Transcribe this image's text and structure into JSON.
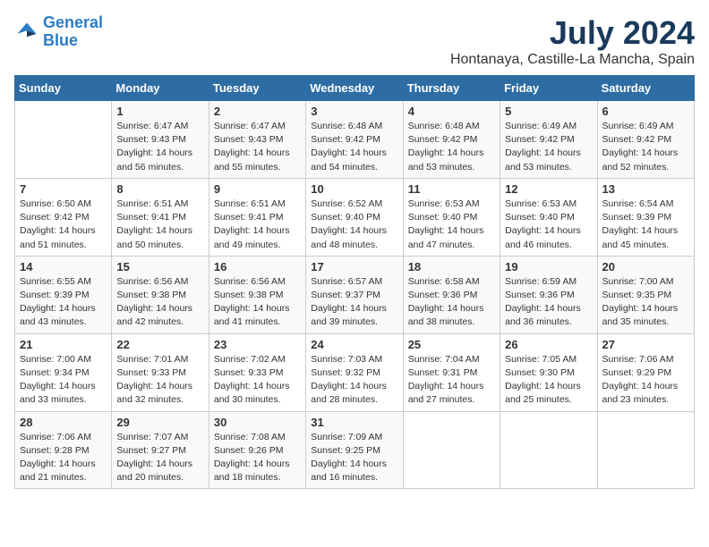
{
  "logo": {
    "line1": "General",
    "line2": "Blue"
  },
  "title": "July 2024",
  "location": "Hontanaya, Castille-La Mancha, Spain",
  "weekdays": [
    "Sunday",
    "Monday",
    "Tuesday",
    "Wednesday",
    "Thursday",
    "Friday",
    "Saturday"
  ],
  "weeks": [
    [
      {
        "day": "",
        "sunrise": "",
        "sunset": "",
        "daylight": ""
      },
      {
        "day": "1",
        "sunrise": "Sunrise: 6:47 AM",
        "sunset": "Sunset: 9:43 PM",
        "daylight": "Daylight: 14 hours and 56 minutes."
      },
      {
        "day": "2",
        "sunrise": "Sunrise: 6:47 AM",
        "sunset": "Sunset: 9:43 PM",
        "daylight": "Daylight: 14 hours and 55 minutes."
      },
      {
        "day": "3",
        "sunrise": "Sunrise: 6:48 AM",
        "sunset": "Sunset: 9:42 PM",
        "daylight": "Daylight: 14 hours and 54 minutes."
      },
      {
        "day": "4",
        "sunrise": "Sunrise: 6:48 AM",
        "sunset": "Sunset: 9:42 PM",
        "daylight": "Daylight: 14 hours and 53 minutes."
      },
      {
        "day": "5",
        "sunrise": "Sunrise: 6:49 AM",
        "sunset": "Sunset: 9:42 PM",
        "daylight": "Daylight: 14 hours and 53 minutes."
      },
      {
        "day": "6",
        "sunrise": "Sunrise: 6:49 AM",
        "sunset": "Sunset: 9:42 PM",
        "daylight": "Daylight: 14 hours and 52 minutes."
      }
    ],
    [
      {
        "day": "7",
        "sunrise": "Sunrise: 6:50 AM",
        "sunset": "Sunset: 9:42 PM",
        "daylight": "Daylight: 14 hours and 51 minutes."
      },
      {
        "day": "8",
        "sunrise": "Sunrise: 6:51 AM",
        "sunset": "Sunset: 9:41 PM",
        "daylight": "Daylight: 14 hours and 50 minutes."
      },
      {
        "day": "9",
        "sunrise": "Sunrise: 6:51 AM",
        "sunset": "Sunset: 9:41 PM",
        "daylight": "Daylight: 14 hours and 49 minutes."
      },
      {
        "day": "10",
        "sunrise": "Sunrise: 6:52 AM",
        "sunset": "Sunset: 9:40 PM",
        "daylight": "Daylight: 14 hours and 48 minutes."
      },
      {
        "day": "11",
        "sunrise": "Sunrise: 6:53 AM",
        "sunset": "Sunset: 9:40 PM",
        "daylight": "Daylight: 14 hours and 47 minutes."
      },
      {
        "day": "12",
        "sunrise": "Sunrise: 6:53 AM",
        "sunset": "Sunset: 9:40 PM",
        "daylight": "Daylight: 14 hours and 46 minutes."
      },
      {
        "day": "13",
        "sunrise": "Sunrise: 6:54 AM",
        "sunset": "Sunset: 9:39 PM",
        "daylight": "Daylight: 14 hours and 45 minutes."
      }
    ],
    [
      {
        "day": "14",
        "sunrise": "Sunrise: 6:55 AM",
        "sunset": "Sunset: 9:39 PM",
        "daylight": "Daylight: 14 hours and 43 minutes."
      },
      {
        "day": "15",
        "sunrise": "Sunrise: 6:56 AM",
        "sunset": "Sunset: 9:38 PM",
        "daylight": "Daylight: 14 hours and 42 minutes."
      },
      {
        "day": "16",
        "sunrise": "Sunrise: 6:56 AM",
        "sunset": "Sunset: 9:38 PM",
        "daylight": "Daylight: 14 hours and 41 minutes."
      },
      {
        "day": "17",
        "sunrise": "Sunrise: 6:57 AM",
        "sunset": "Sunset: 9:37 PM",
        "daylight": "Daylight: 14 hours and 39 minutes."
      },
      {
        "day": "18",
        "sunrise": "Sunrise: 6:58 AM",
        "sunset": "Sunset: 9:36 PM",
        "daylight": "Daylight: 14 hours and 38 minutes."
      },
      {
        "day": "19",
        "sunrise": "Sunrise: 6:59 AM",
        "sunset": "Sunset: 9:36 PM",
        "daylight": "Daylight: 14 hours and 36 minutes."
      },
      {
        "day": "20",
        "sunrise": "Sunrise: 7:00 AM",
        "sunset": "Sunset: 9:35 PM",
        "daylight": "Daylight: 14 hours and 35 minutes."
      }
    ],
    [
      {
        "day": "21",
        "sunrise": "Sunrise: 7:00 AM",
        "sunset": "Sunset: 9:34 PM",
        "daylight": "Daylight: 14 hours and 33 minutes."
      },
      {
        "day": "22",
        "sunrise": "Sunrise: 7:01 AM",
        "sunset": "Sunset: 9:33 PM",
        "daylight": "Daylight: 14 hours and 32 minutes."
      },
      {
        "day": "23",
        "sunrise": "Sunrise: 7:02 AM",
        "sunset": "Sunset: 9:33 PM",
        "daylight": "Daylight: 14 hours and 30 minutes."
      },
      {
        "day": "24",
        "sunrise": "Sunrise: 7:03 AM",
        "sunset": "Sunset: 9:32 PM",
        "daylight": "Daylight: 14 hours and 28 minutes."
      },
      {
        "day": "25",
        "sunrise": "Sunrise: 7:04 AM",
        "sunset": "Sunset: 9:31 PM",
        "daylight": "Daylight: 14 hours and 27 minutes."
      },
      {
        "day": "26",
        "sunrise": "Sunrise: 7:05 AM",
        "sunset": "Sunset: 9:30 PM",
        "daylight": "Daylight: 14 hours and 25 minutes."
      },
      {
        "day": "27",
        "sunrise": "Sunrise: 7:06 AM",
        "sunset": "Sunset: 9:29 PM",
        "daylight": "Daylight: 14 hours and 23 minutes."
      }
    ],
    [
      {
        "day": "28",
        "sunrise": "Sunrise: 7:06 AM",
        "sunset": "Sunset: 9:28 PM",
        "daylight": "Daylight: 14 hours and 21 minutes."
      },
      {
        "day": "29",
        "sunrise": "Sunrise: 7:07 AM",
        "sunset": "Sunset: 9:27 PM",
        "daylight": "Daylight: 14 hours and 20 minutes."
      },
      {
        "day": "30",
        "sunrise": "Sunrise: 7:08 AM",
        "sunset": "Sunset: 9:26 PM",
        "daylight": "Daylight: 14 hours and 18 minutes."
      },
      {
        "day": "31",
        "sunrise": "Sunrise: 7:09 AM",
        "sunset": "Sunset: 9:25 PM",
        "daylight": "Daylight: 14 hours and 16 minutes."
      },
      {
        "day": "",
        "sunrise": "",
        "sunset": "",
        "daylight": ""
      },
      {
        "day": "",
        "sunrise": "",
        "sunset": "",
        "daylight": ""
      },
      {
        "day": "",
        "sunrise": "",
        "sunset": "",
        "daylight": ""
      }
    ]
  ]
}
